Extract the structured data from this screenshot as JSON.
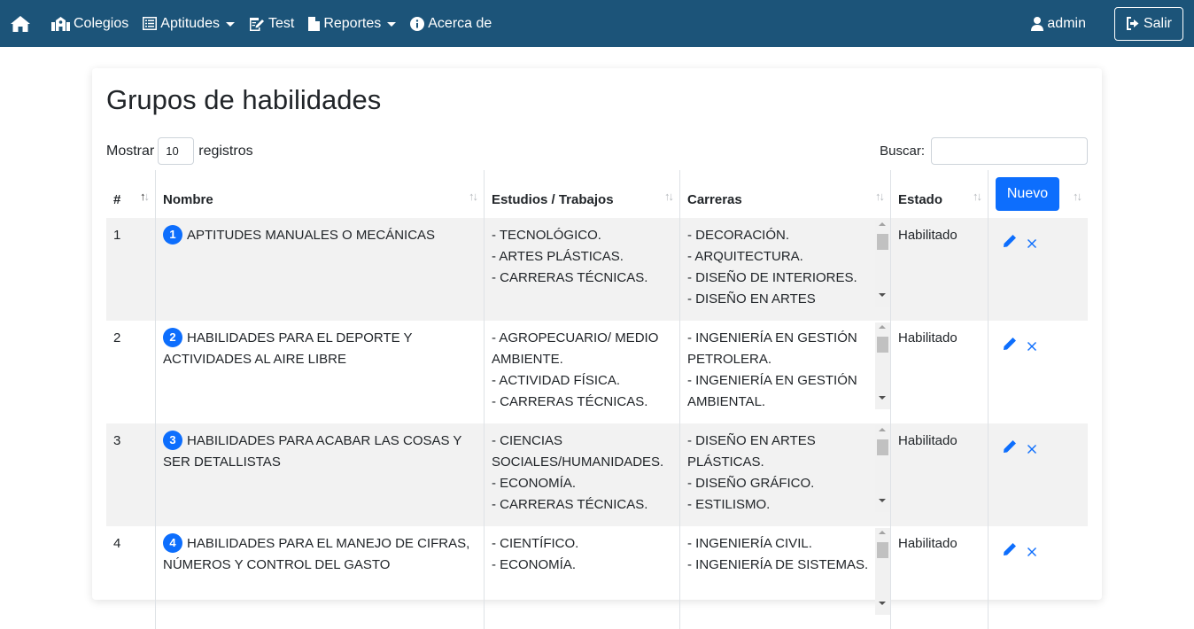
{
  "navbar": {
    "colegios": "Colegios",
    "aptitudes": "Aptitudes",
    "test": "Test",
    "reportes": "Reportes",
    "acerca": "Acerca de",
    "user": "admin",
    "salir": "Salir"
  },
  "page": {
    "title": "Grupos de habilidades",
    "show_label": "Mostrar",
    "show_value": "10",
    "records_label": "registros",
    "search_label": "Buscar:",
    "search_value": ""
  },
  "table": {
    "headers": {
      "num": "#",
      "nombre": "Nombre",
      "estudios": "Estudios / Trabajos",
      "carreras": "Carreras",
      "estado": "Estado",
      "nuevo": "Nuevo"
    },
    "rows": [
      {
        "num": "1",
        "badge": "1",
        "nombre": "APTITUDES MANUALES O MECÁNICAS",
        "estudios": [
          "- TECNOLÓGICO.",
          "- ARTES PLÁSTICAS.",
          "- CARRERAS TÉCNICAS."
        ],
        "carreras": [
          "- DECORACIÓN.",
          "- ARQUITECTURA.",
          "- DISEÑO DE INTERIORES.",
          "- DISEÑO EN ARTES"
        ],
        "estado": "Habilitado"
      },
      {
        "num": "2",
        "badge": "2",
        "nombre": "HABILIDADES PARA EL DEPORTE Y ACTIVIDADES AL AIRE LIBRE",
        "estudios": [
          "- AGROPECUARIO/ MEDIO",
          "AMBIENTE.",
          "- ACTIVIDAD FÍSICA.",
          "- CARRERAS TÉCNICAS."
        ],
        "carreras": [
          "- INGENIERÍA EN GESTIÓN",
          "PETROLERA.",
          "- INGENIERÍA EN GESTIÓN",
          "AMBIENTAL."
        ],
        "estado": "Habilitado"
      },
      {
        "num": "3",
        "badge": "3",
        "nombre": "HABILIDADES PARA ACABAR LAS COSAS Y SER DETALLISTAS",
        "estudios": [
          "- CIENCIAS",
          "SOCIALES/HUMANIDADES.",
          "- ECONOMÍA.",
          "- CARRERAS TÉCNICAS."
        ],
        "carreras": [
          "- DISEÑO EN ARTES",
          "PLÁSTICAS.",
          "- DISEÑO GRÁFICO.",
          "- ESTILISMO."
        ],
        "estado": "Habilitado"
      },
      {
        "num": "4",
        "badge": "4",
        "nombre": "HABILIDADES PARA EL MANEJO DE CIFRAS, NÚMEROS Y CONTROL DEL GASTO",
        "estudios": [
          "- CIENTÍFICO.",
          "- ECONOMÍA."
        ],
        "carreras": [
          "- INGENIERÍA CIVIL.",
          "- INGENIERÍA DE SISTEMAS."
        ],
        "estado": "Habilitado"
      }
    ]
  }
}
